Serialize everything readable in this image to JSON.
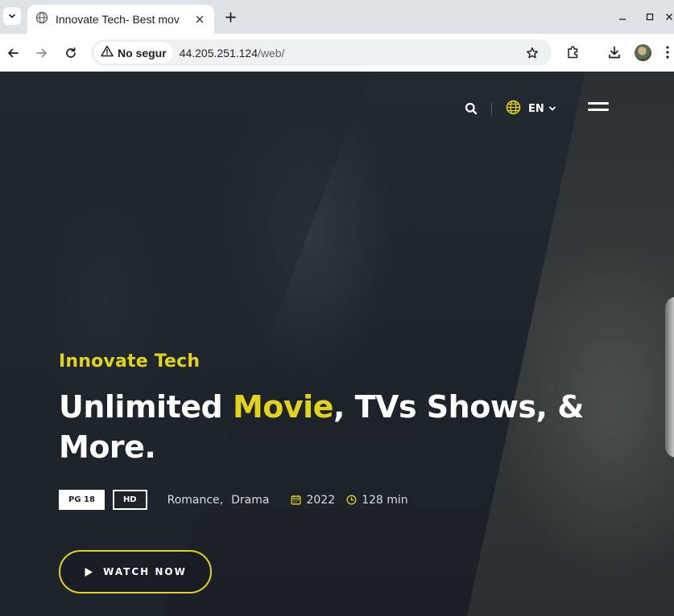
{
  "browser": {
    "tab_title": "Innovate Tech- Best mov",
    "security_label": "No segur",
    "url_host": "44.205.251.124",
    "url_path": "/web/"
  },
  "site": {
    "lang": "EN",
    "eyebrow": "Innovate Tech",
    "headline_part1": "Unlimited ",
    "headline_highlight": "Movie",
    "headline_part2": ", TVs Shows, & More.",
    "rating_badge": "PG 18",
    "quality_badge": "HD",
    "genres": [
      "Romance,",
      "Drama"
    ],
    "year": "2022",
    "duration": "128 min",
    "cta_label": "WATCH NOW"
  },
  "colors": {
    "accent": "#e2d21a",
    "hero_bg": "#1e242b",
    "chrome_bg": "#dfe3e8"
  }
}
